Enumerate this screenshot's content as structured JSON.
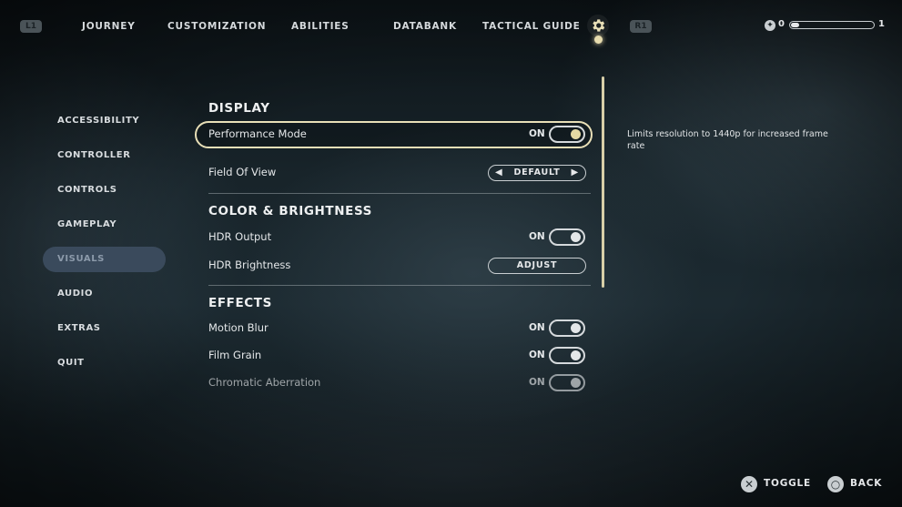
{
  "topbar": {
    "left_button": "L1",
    "right_button": "R1",
    "tabs": [
      {
        "label": "JOURNEY"
      },
      {
        "label": "CUSTOMIZATION"
      },
      {
        "label": "ABILITIES"
      },
      {
        "label": "DATABANK"
      },
      {
        "label": "TACTICAL GUIDE"
      }
    ],
    "active_tab_icon": "gear-icon",
    "skill_points": "0",
    "level_next": "1",
    "xp_progress": 0.1
  },
  "sidebar": {
    "items": [
      {
        "label": "ACCESSIBILITY"
      },
      {
        "label": "CONTROLLER"
      },
      {
        "label": "CONTROLS"
      },
      {
        "label": "GAMEPLAY"
      },
      {
        "label": "VISUALS",
        "active": true
      },
      {
        "label": "AUDIO"
      },
      {
        "label": "EXTRAS"
      },
      {
        "label": "QUIT"
      }
    ]
  },
  "settings": {
    "display": {
      "title": "DISPLAY",
      "performance_mode": {
        "label": "Performance Mode",
        "value": "ON"
      },
      "field_of_view": {
        "label": "Field Of View",
        "value": "DEFAULT"
      }
    },
    "color": {
      "title": "COLOR & BRIGHTNESS",
      "hdr_output": {
        "label": "HDR Output",
        "value": "ON"
      },
      "hdr_brightness": {
        "label": "HDR Brightness",
        "button": "ADJUST"
      }
    },
    "effects": {
      "title": "EFFECTS",
      "motion_blur": {
        "label": "Motion Blur",
        "value": "ON"
      },
      "film_grain": {
        "label": "Film Grain",
        "value": "ON"
      },
      "chromatic_aberration": {
        "label": "Chromatic Aberration",
        "value": "ON"
      }
    }
  },
  "description": "Limits resolution to 1440p for increased frame rate",
  "footer": {
    "toggle_label": "TOGGLE",
    "back_label": "BACK"
  },
  "colors": {
    "accent": "#e8dfb7",
    "active_item": "#3a4a5c"
  }
}
